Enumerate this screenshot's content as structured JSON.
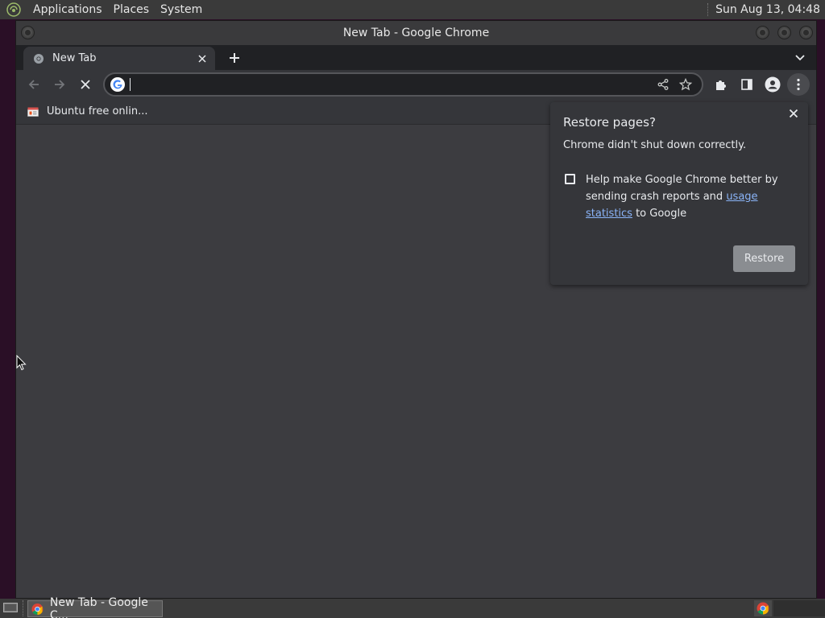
{
  "top_panel": {
    "menus": [
      "Applications",
      "Places",
      "System"
    ],
    "clock": "Sun Aug 13, 04:48"
  },
  "window": {
    "title": "New Tab - Google Chrome"
  },
  "tabs": [
    {
      "label": "New Tab"
    }
  ],
  "omnibox": {
    "value": ""
  },
  "bookmarks": [
    {
      "label": "Ubuntu free onlin..."
    }
  ],
  "restore_dialog": {
    "heading": "Restore pages?",
    "description": "Chrome didn't shut down correctly.",
    "checkbox_text_before": "Help make Google Chrome better by sending crash reports and ",
    "checkbox_link": "usage statistics",
    "checkbox_text_after": " to Google",
    "checked": false,
    "restore_label": "Restore"
  },
  "taskbar": {
    "task_label": "New Tab - Google C..."
  },
  "colors": {
    "accent_link": "#8ab4f8",
    "toolbar": "#35363a",
    "page": "#3c3c40"
  }
}
